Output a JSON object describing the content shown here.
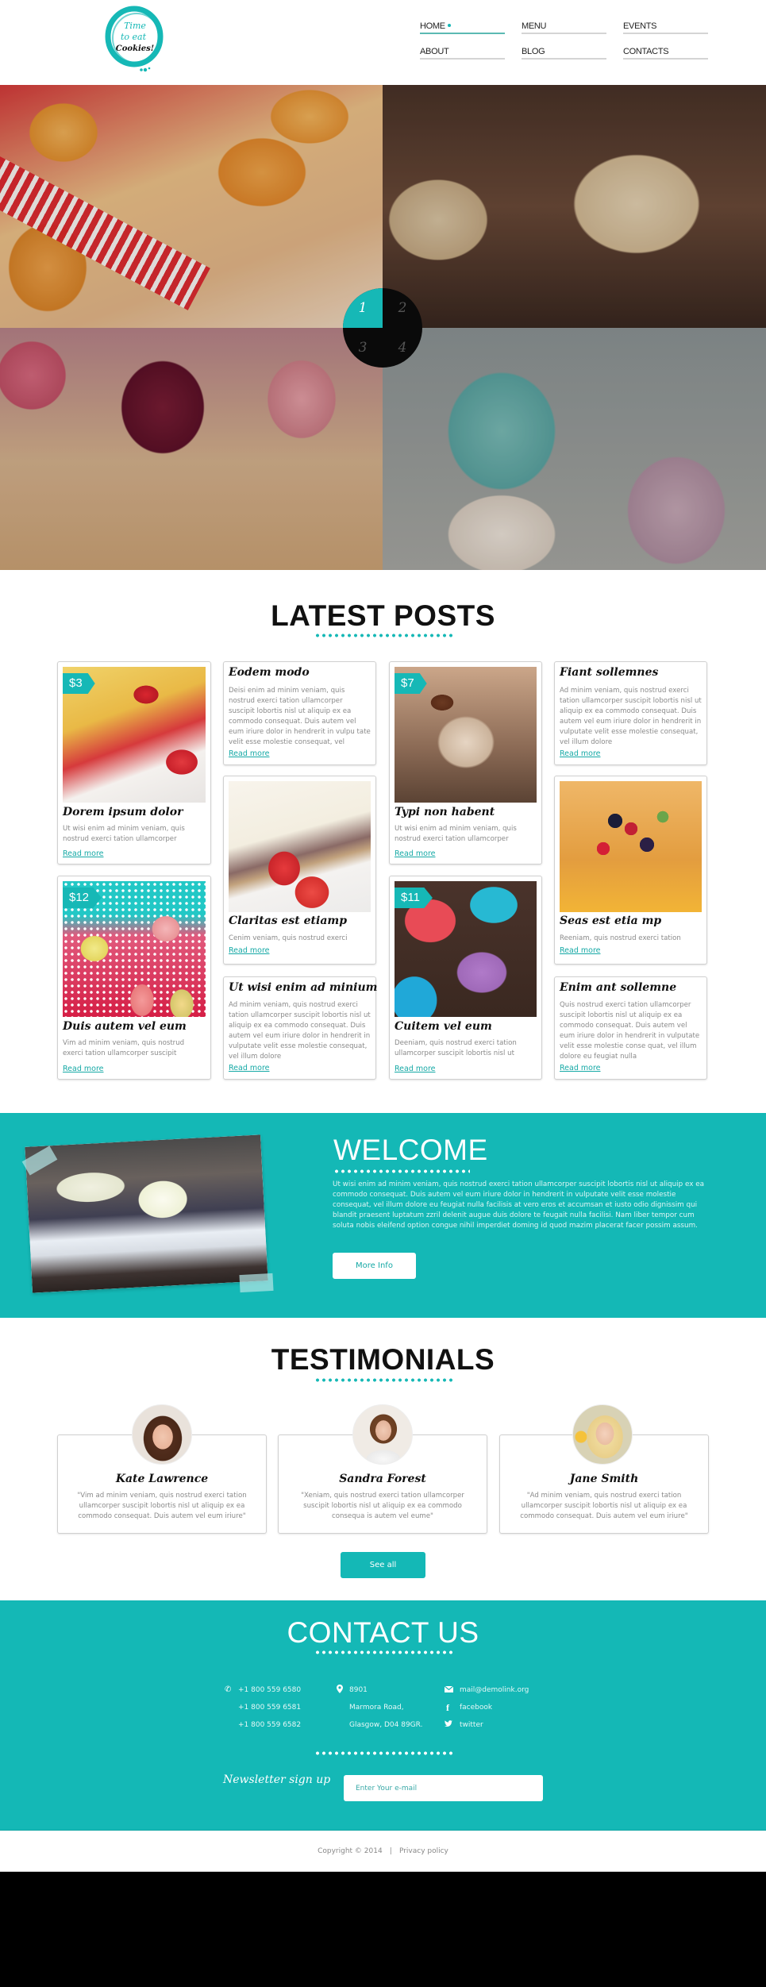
{
  "brand": {
    "logo_lines": [
      "Time",
      "to eat",
      "Cookies!"
    ],
    "accent_color": "#14b8b6"
  },
  "nav": {
    "items": [
      {
        "label": "HOME",
        "active": true
      },
      {
        "label": "MENU",
        "active": false
      },
      {
        "label": "EVENTS",
        "active": false
      },
      {
        "label": "ABOUT",
        "active": false
      },
      {
        "label": "BLOG",
        "active": false
      },
      {
        "label": "CONTACTS",
        "active": false
      }
    ]
  },
  "hero": {
    "slides": [
      {
        "label": "1",
        "alt": "muffins with gingham ribbon"
      },
      {
        "label": "2",
        "alt": "chocolate cupcakes with cream frosting"
      },
      {
        "label": "3",
        "alt": "sorbet ice cream cones"
      },
      {
        "label": "4",
        "alt": "macarons"
      }
    ],
    "active_slide": 1
  },
  "latest_posts": {
    "title": "LATEST POSTS",
    "read_more": "Read more",
    "posts": [
      {
        "title": "Dorem ipsum dolor",
        "price": "$3",
        "text": "Ut wisi enim ad minim veniam, quis nostrud exerci tation ullamcorper"
      },
      {
        "title": "Eodem modo",
        "text": "Deisi enim ad minim veniam, quis nostrud exerci tation ullamcorper suscipit lobortis nisl ut aliquip ex ea commodo consequat. Duis autem vel eum iriure dolor in hendrerit in vulpu tate velit esse molestie consequat, vel"
      },
      {
        "title": "Typi non habent",
        "price": "$7",
        "text": "Ut wisi enim ad minim veniam, quis nostrud exerci tation ullamcorper"
      },
      {
        "title": "Fiant sollemnes",
        "text": "Ad minim veniam, quis nostrud exerci tation ullamcorper suscipit lobortis nisl ut aliquip ex ea commodo consequat. Duis autem vel eum iriure dolor in hendrerit in vulputate velit esse molestie consequat, vel illum dolore"
      },
      {
        "title": "Claritas est etiamp",
        "text": "Cenim veniam, quis nostrud exerci"
      },
      {
        "title": "Seas est etia mp",
        "text": "Reeniam, quis nostrud exerci tation"
      },
      {
        "title": "Duis autem vel eum",
        "price": "$12",
        "text": "Vim ad minim veniam, quis nostrud exerci tation ullamcorper suscipit"
      },
      {
        "title": "Ut wisi enim ad minium",
        "text": "Ad minim veniam, quis nostrud exerci tation ullamcorper suscipit lobortis nisl ut aliquip ex ea commodo consequat. Duis autem vel eum iriure dolor in hendrerit in vulputate velit esse molestie consequat, vel illum dolore"
      },
      {
        "title": "Cuitem vel eum",
        "price": "$11",
        "text": "Deeniam, quis nostrud exerci tation ullamcorper suscipit lobortis nisl ut"
      },
      {
        "title": "Enim ant sollemne",
        "text": "Quis nostrud exerci tation ullamcorper suscipit lobortis nisl ut aliquip ex ea commodo consequat. Duis autem vel eum iriure dolor in hendrerit in vulputate velit esse molestie conse quat, vel illum dolore eu feugiat nulla"
      }
    ]
  },
  "welcome": {
    "title": "WELCOME",
    "text": "Ut wisi enim ad minim veniam, quis nostrud exerci tation ullamcorper suscipit lobortis nisl ut aliquip ex ea commodo consequat. Duis autem vel eum iriure dolor in hendrerit in vulputate velit esse molestie consequat, vel illum dolore eu feugiat nulla facilisis at vero eros et accumsan et iusto odio dignissim qui blandit praesent luptatum zzril delenit augue duis dolore te feugait nulla facilisi. Nam liber tempor cum soluta nobis eleifend option congue nihil imperdiet doming id quod mazim placerat facer possim assum.",
    "button": "More Info"
  },
  "testimonials": {
    "title": "TESTIMONIALS",
    "items": [
      {
        "name": "Kate Lawrence",
        "quote": "\"Vim ad minim veniam, quis nostrud exerci tation ullamcorper suscipit lobortis nisl ut aliquip ex ea commodo consequat. Duis autem vel eum iriure\""
      },
      {
        "name": "Sandra Forest",
        "quote": "\"Xeniam, quis nostrud exerci tation ullamcorper suscipit lobortis nisl ut aliquip ex ea commodo consequa is autem vel eume\""
      },
      {
        "name": "Jane Smith",
        "quote": "\"Ad minim veniam, quis nostrud exerci tation ullamcorper suscipit lobortis nisl ut aliquip ex ea commodo consequat. Duis autem vel eum iriure\""
      }
    ],
    "button": "See all"
  },
  "contact": {
    "title": "CONTACT US",
    "phones": [
      "+1 800 559 6580",
      "+1 800 559 6581",
      "+1 800 559 6582"
    ],
    "address": [
      "8901",
      "Marmora Road,",
      "Glasgow, D04 89GR."
    ],
    "email": "mail@demolink.org",
    "facebook": "facebook",
    "twitter": "twitter",
    "newsletter_label": "Newsletter sign up",
    "newsletter_placeholder": "Enter Your e-mail"
  },
  "footer": {
    "copyright": "Copyright © 2014",
    "separator": "|",
    "privacy": "Privacy policy"
  }
}
